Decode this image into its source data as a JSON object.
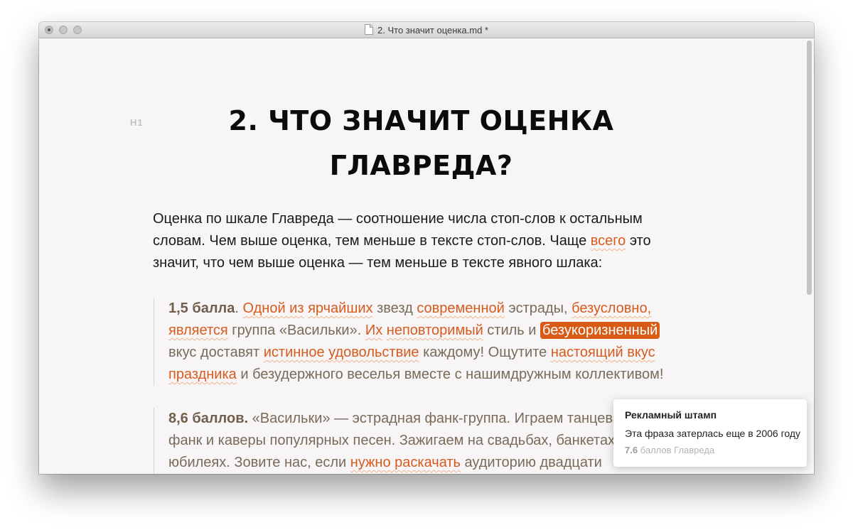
{
  "window": {
    "title": "2. Что значит оценка.md *"
  },
  "editor": {
    "heading_marker": "H1",
    "heading_line1": "2. ЧТО ЗНАЧИТ ОЦЕНКА",
    "heading_line2": "ГЛАВРЕДА?",
    "paragraph": {
      "text1": "Оценка по шкале Главреда — соотношение числа стоп-слов к остальным словам. Чем выше оценка, тем меньше в тексте стоп-слов. Чаще ",
      "flag1": "всего",
      "text2": " это значит, что чем выше оценка — тем меньше в тексте явного шлака:"
    },
    "quote1": {
      "score": "1,5 балла",
      "t1": ". ",
      "f1": "Одной из",
      "t2": "  ",
      "f2": "ярчайших",
      "t3": " звезд ",
      "f3": "современной",
      "t4": " эстрады, ",
      "f4": "безусловно,",
      "t5": " ",
      "f5": "является",
      "t6": " группа «Васильки». ",
      "f6": "Их",
      "t7": " ",
      "f7": "неповторимый",
      "t8": " стиль и ",
      "f8": "безукоризненный",
      "t9": " вкус доставят ",
      "f9": "истинное удовольствие",
      "t10": " каждому! Ощутите ",
      "f10": "настоящий вкус праздника",
      "t11": " и безудержного веселья вместе с нашимдружным коллективом!"
    },
    "quote2": {
      "score": "8,6 баллов.",
      "t1": " «Васильки» — эстрадная фанк-группа. Играем танцевальный фанк и каверы популярных песен. Зажигаем на свадьбах, банкетах и юбилеях. Зовите нас, если ",
      "f1": "нужно раскачать",
      "t2": " аудиторию двадцати"
    }
  },
  "tooltip": {
    "title": "Рекламный штамп",
    "text": "Эта фраза затерлась еще в 2006 году",
    "score_value": "7.6",
    "score_label": " баллов Главреда"
  },
  "colors": {
    "accent": "#d75b1e",
    "active_highlight": "#d85a14",
    "quote_text": "#7a6a5a",
    "background": "#f7f5f5"
  }
}
